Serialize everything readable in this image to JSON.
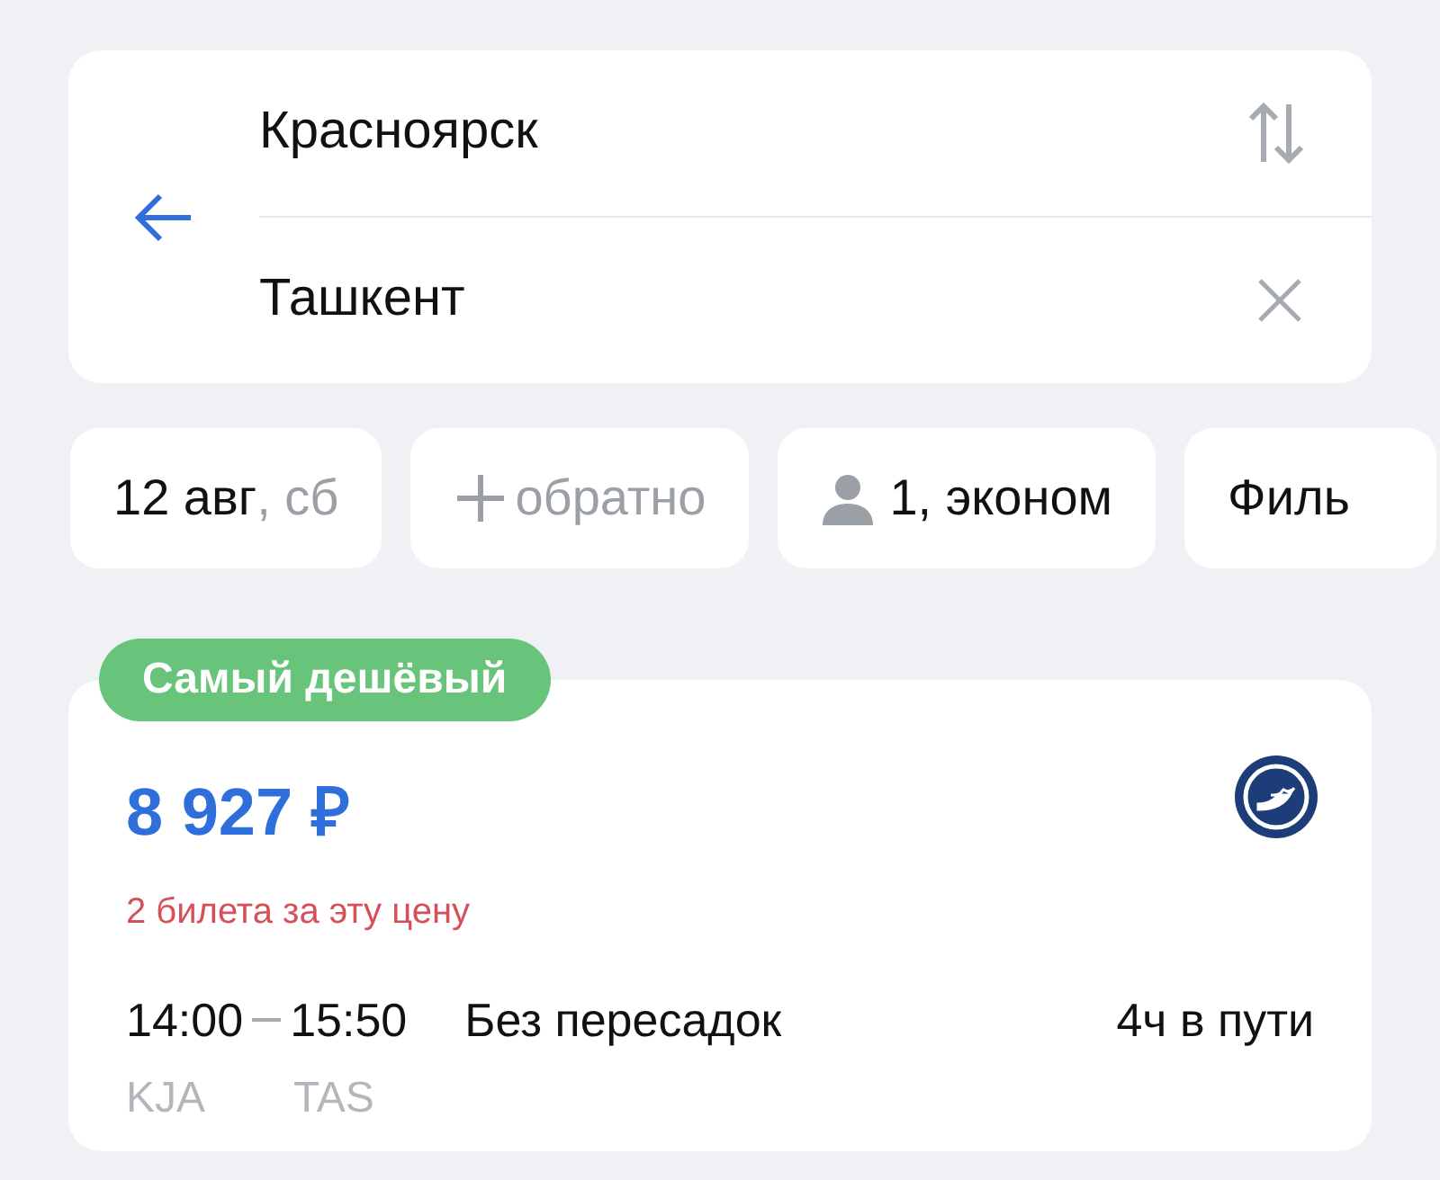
{
  "route": {
    "from": "Красноярск",
    "to": "Ташкент"
  },
  "chips": [
    {
      "kind": "date",
      "label": "12 авг",
      "sub": ", сб"
    },
    {
      "kind": "add",
      "label": "обратно"
    },
    {
      "kind": "passengers",
      "label": "1, эконом"
    },
    {
      "kind": "filter",
      "label": "Филь"
    }
  ],
  "result": {
    "badge": "Самый дешёвый",
    "price": "8 927 ₽",
    "note": "2 билета за эту цену",
    "depart": "14:00",
    "arrive": "15:50",
    "stops": "Без пересадок",
    "duration": "4ч в пути",
    "from_code": "KJA",
    "to_code": "TAS"
  }
}
